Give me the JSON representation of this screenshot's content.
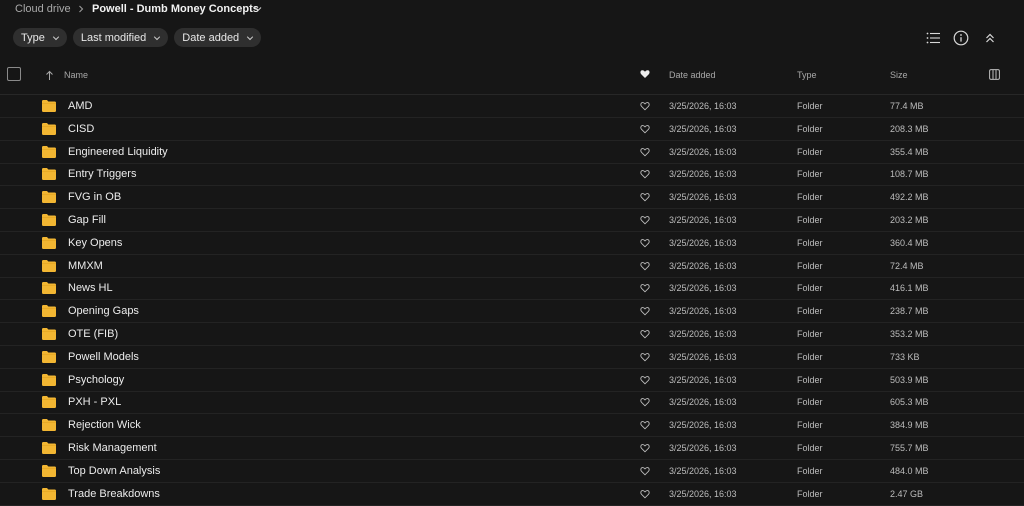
{
  "breadcrumb": {
    "root": "Cloud drive",
    "current": "Powell - Dumb Money Concepts"
  },
  "filters": [
    {
      "label": "Type"
    },
    {
      "label": "Last modified"
    },
    {
      "label": "Date added"
    }
  ],
  "columns": {
    "name": "Name",
    "date_added": "Date added",
    "type": "Type",
    "size": "Size"
  },
  "colors": {
    "background": "#161616",
    "chip": "#2f2f2f",
    "folder": "#f2b632"
  },
  "rows": [
    {
      "name": "AMD",
      "date": "3/25/2026, 16:03",
      "type": "Folder",
      "size": "77.4 MB"
    },
    {
      "name": "CISD",
      "date": "3/25/2026, 16:03",
      "type": "Folder",
      "size": "208.3 MB"
    },
    {
      "name": "Engineered Liquidity",
      "date": "3/25/2026, 16:03",
      "type": "Folder",
      "size": "355.4 MB"
    },
    {
      "name": "Entry Triggers",
      "date": "3/25/2026, 16:03",
      "type": "Folder",
      "size": "108.7 MB"
    },
    {
      "name": "FVG in OB",
      "date": "3/25/2026, 16:03",
      "type": "Folder",
      "size": "492.2 MB"
    },
    {
      "name": "Gap Fill",
      "date": "3/25/2026, 16:03",
      "type": "Folder",
      "size": "203.2 MB"
    },
    {
      "name": "Key Opens",
      "date": "3/25/2026, 16:03",
      "type": "Folder",
      "size": "360.4 MB"
    },
    {
      "name": "MMXM",
      "date": "3/25/2026, 16:03",
      "type": "Folder",
      "size": "72.4 MB"
    },
    {
      "name": "News HL",
      "date": "3/25/2026, 16:03",
      "type": "Folder",
      "size": "416.1 MB"
    },
    {
      "name": "Opening Gaps",
      "date": "3/25/2026, 16:03",
      "type": "Folder",
      "size": "238.7 MB"
    },
    {
      "name": "OTE (FIB)",
      "date": "3/25/2026, 16:03",
      "type": "Folder",
      "size": "353.2 MB"
    },
    {
      "name": "Powell Models",
      "date": "3/25/2026, 16:03",
      "type": "Folder",
      "size": "733 KB"
    },
    {
      "name": "Psychology",
      "date": "3/25/2026, 16:03",
      "type": "Folder",
      "size": "503.9 MB"
    },
    {
      "name": "PXH - PXL",
      "date": "3/25/2026, 16:03",
      "type": "Folder",
      "size": "605.3 MB"
    },
    {
      "name": "Rejection Wick",
      "date": "3/25/2026, 16:03",
      "type": "Folder",
      "size": "384.9 MB"
    },
    {
      "name": "Risk Management",
      "date": "3/25/2026, 16:03",
      "type": "Folder",
      "size": "755.7 MB"
    },
    {
      "name": "Top Down Analysis",
      "date": "3/25/2026, 16:03",
      "type": "Folder",
      "size": "484.0 MB"
    },
    {
      "name": "Trade Breakdowns",
      "date": "3/25/2026, 16:03",
      "type": "Folder",
      "size": "2.47 GB"
    }
  ]
}
